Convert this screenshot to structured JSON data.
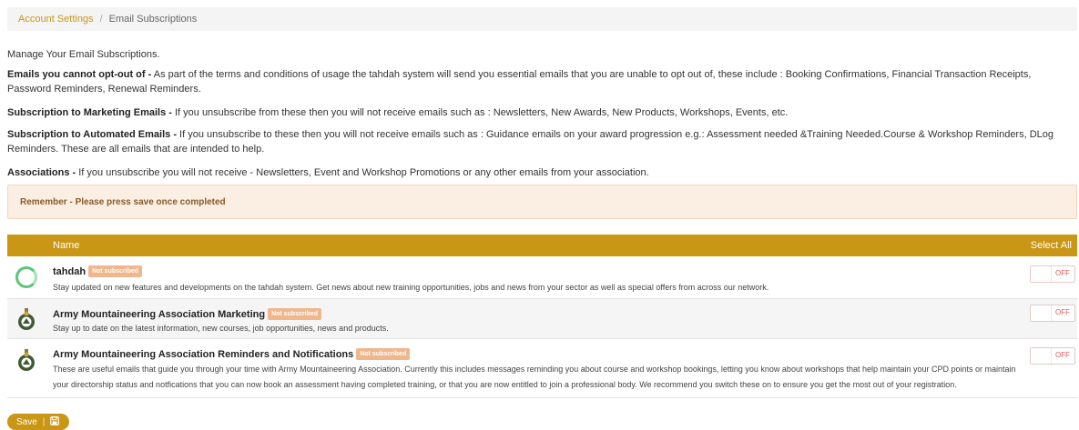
{
  "breadcrumb": {
    "parent": "Account Settings",
    "separator": "/",
    "current": "Email Subscriptions"
  },
  "intro": "Manage Your Email Subscriptions.",
  "paragraphs": [
    {
      "heading": "Emails you cannot opt-out of -",
      "text": " As part of the terms and conditions of usage the tahdah system will send you essential emails that you are unable to opt out of, these include : Booking Confirmations, Financial Transaction Receipts, Password Reminders, Renewal Reminders."
    },
    {
      "heading": "Subscription to Marketing Emails -",
      "text": " If you unsubscribe from these then you will not receive emails such as : Newsletters, New Awards, New Products, Workshops, Events, etc."
    },
    {
      "heading": "Subscription to Automated Emails -",
      "text": " If you unsubscribe to these then you will not receive emails such as : Guidance emails on your award progression e.g.: Assessment needed &Training Needed.Course & Workshop Reminders, DLog Reminders. These are all emails that are intended to help."
    },
    {
      "heading": "Associations -",
      "text": " If you unsubscribe you will not receive - Newsletters, Event and Workshop Promotions or any other emails from your association."
    }
  ],
  "alert": "Remember - Please press save once completed",
  "table": {
    "col_name": "Name",
    "select_all": "Select All",
    "rows": [
      {
        "title": "tahdah",
        "badge": "Not subscribed",
        "desc": "Stay updated on new features and developments on the tahdah system. Get news about new training opportunities, jobs and news from your sector as well as special offers from across our network.",
        "toggle": "OFF",
        "logo": "tahdah-ring-logo"
      },
      {
        "title": "Army Mountaineering Association Marketing",
        "badge": "Not subscribed",
        "desc": "Stay up to date on the latest information, new courses, job opportunities, news and products.",
        "toggle": "OFF",
        "logo": "association-crest-logo"
      },
      {
        "title": "Army Mountaineering Association Reminders and Notifications",
        "badge": "Not subscribed",
        "desc": "These are useful emails that guide you through your time with Army Mountaineering Association. Currently this includes messages reminding you about course and workshop bookings, letting you know about workshops that help maintain your CPD points or maintain your directorship status and notfications that you can now book an assessment having completed training, or that you are now entitled to join a professional body. We recommend you switch these on to ensure you get the most out of your registration.",
        "toggle": "OFF",
        "logo": "association-crest-logo"
      }
    ]
  },
  "save_button": {
    "label": "Save",
    "separator": "|",
    "icon": "save-icon"
  },
  "colors": {
    "accent": "#c99615",
    "link": "#c9951b",
    "badge": "#f0b68c",
    "alert_bg": "#fbeee2",
    "toggle_off": "#e05a5a"
  }
}
